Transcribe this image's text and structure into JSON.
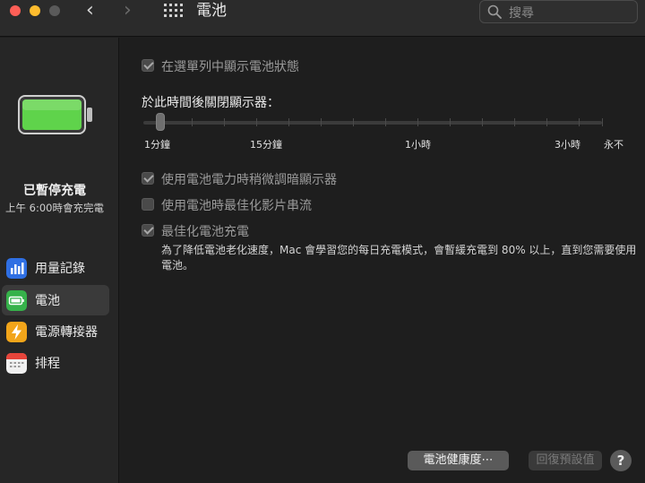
{
  "window": {
    "title": "電池",
    "nav_back": "‹",
    "nav_forward": "›",
    "search_placeholder": "搜尋"
  },
  "sidebar": {
    "status_title": "已暫停充電",
    "status_subtitle": "上午 6:00時會充完電",
    "items": [
      {
        "label": "用量記錄",
        "icon": "usage-history-icon",
        "color": "#2f6fe3"
      },
      {
        "label": "電池",
        "icon": "battery-icon",
        "color": "#36b24a",
        "selected": true
      },
      {
        "label": "電源轉接器",
        "icon": "power-adapter-icon",
        "color": "#f2a51a"
      },
      {
        "label": "排程",
        "icon": "calendar-icon",
        "color": "#f0f0f0"
      }
    ]
  },
  "main": {
    "show_in_menubar": {
      "label": "在選單列中顯示電池狀態",
      "checked": true
    },
    "display_off_title": "於此時間後關閉顯示器：",
    "slider": {
      "labels": [
        "1分鐘",
        "15分鐘",
        "1小時",
        "3小時",
        "永不"
      ],
      "value": "1分鐘"
    },
    "dim_display": {
      "label": "使用電池電力時稍微調暗顯示器",
      "checked": true
    },
    "optimize_video": {
      "label": "使用電池時最佳化影片串流",
      "checked": false
    },
    "optimized_charging": {
      "label": "最佳化電池充電",
      "checked": true,
      "description": "為了降低電池老化速度，Mac 會學習您的每日充電模式，會暫緩充電到 80% 以上，直到您需要使用電池。"
    },
    "buttons": {
      "battery_health": "電池健康度⋯",
      "restore_defaults": "回復預設值",
      "help": "?"
    }
  },
  "colors": {
    "battery_green": "#5fd34b",
    "accent_red": "#fe5f57",
    "accent_yellow": "#febc2e"
  }
}
